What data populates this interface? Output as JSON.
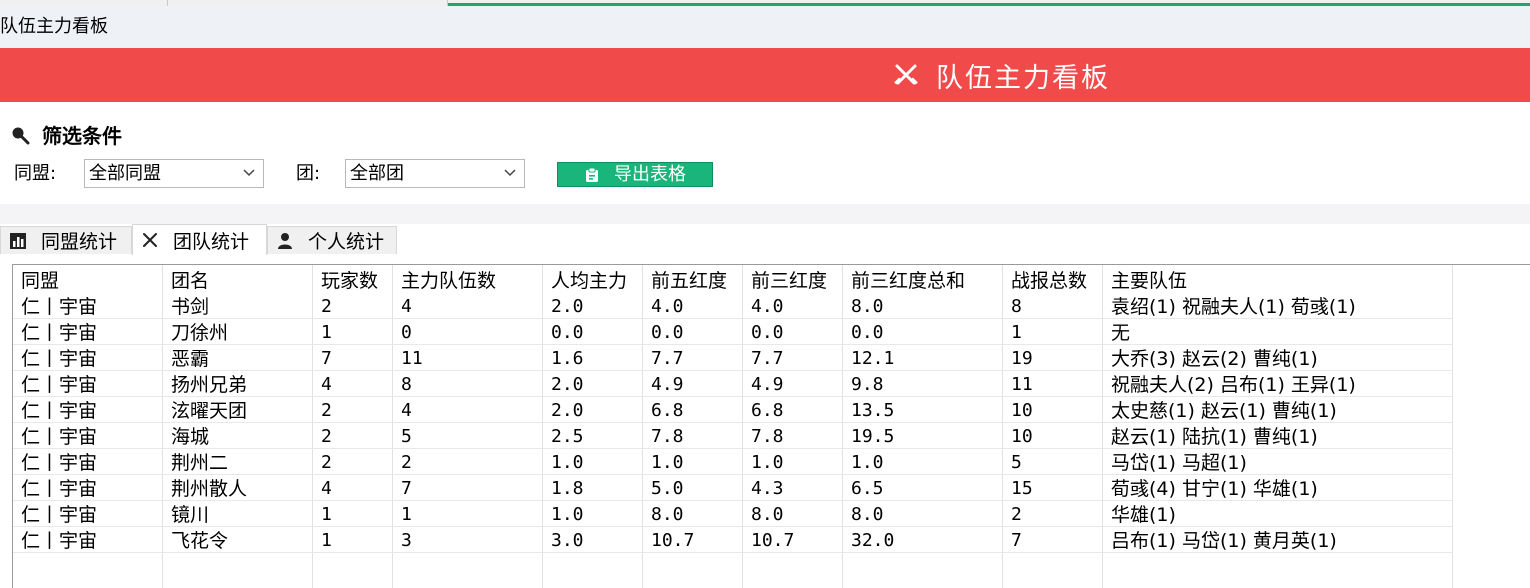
{
  "window": {
    "title": "队伍主力看板"
  },
  "banner": {
    "title": "队伍主力看板",
    "icon": "crossed-swords-icon"
  },
  "filters": {
    "heading": "筛选条件",
    "alliance_label": "同盟:",
    "alliance_value": "全部同盟",
    "group_label": "团:",
    "group_value": "全部团",
    "export_label": "导出表格"
  },
  "tabs": [
    {
      "label": "同盟统计",
      "icon": "bar-chart-icon"
    },
    {
      "label": "团队统计",
      "icon": "crossed-swords-icon"
    },
    {
      "label": "个人统计",
      "icon": "person-icon"
    }
  ],
  "table": {
    "headers": [
      "同盟",
      "团名",
      "玩家数",
      "主力队伍数",
      "人均主力",
      "前五红度",
      "前三红度",
      "前三红度总和",
      "战报总数",
      "主要队伍"
    ],
    "rows": [
      [
        "仁丨宇宙",
        "书剑",
        "2",
        "4",
        "2.0",
        "4.0",
        "4.0",
        "8.0",
        "8",
        "袁绍(1) 祝融夫人(1) 荀彧(1)"
      ],
      [
        "仁丨宇宙",
        "刀徐州",
        "1",
        "0",
        "0.0",
        "0.0",
        "0.0",
        "0.0",
        "1",
        "无"
      ],
      [
        "仁丨宇宙",
        "恶霸",
        "7",
        "11",
        "1.6",
        "7.7",
        "7.7",
        "12.1",
        "19",
        "大乔(3) 赵云(2) 曹纯(1)"
      ],
      [
        "仁丨宇宙",
        "扬州兄弟",
        "4",
        "8",
        "2.0",
        "4.9",
        "4.9",
        "9.8",
        "11",
        "祝融夫人(2) 吕布(1) 王异(1)"
      ],
      [
        "仁丨宇宙",
        "泫曜天团",
        "2",
        "4",
        "2.0",
        "6.8",
        "6.8",
        "13.5",
        "10",
        "太史慈(1) 赵云(1) 曹纯(1)"
      ],
      [
        "仁丨宇宙",
        "海城",
        "2",
        "5",
        "2.5",
        "7.8",
        "7.8",
        "19.5",
        "10",
        "赵云(1) 陆抗(1) 曹纯(1)"
      ],
      [
        "仁丨宇宙",
        "荆州二",
        "2",
        "2",
        "1.0",
        "1.0",
        "1.0",
        "1.0",
        "5",
        "马岱(1) 马超(1)"
      ],
      [
        "仁丨宇宙",
        "荆州散人",
        "4",
        "7",
        "1.8",
        "5.0",
        "4.3",
        "6.5",
        "15",
        "荀彧(4) 甘宁(1) 华雄(1)"
      ],
      [
        "仁丨宇宙",
        "镜川",
        "1",
        "1",
        "1.0",
        "8.0",
        "8.0",
        "8.0",
        "2",
        "华雄(1)"
      ],
      [
        "仁丨宇宙",
        "飞花令",
        "1",
        "3",
        "3.0",
        "10.7",
        "10.7",
        "32.0",
        "7",
        "吕布(1) 马岱(1) 黄月英(1)"
      ]
    ]
  },
  "colors": {
    "banner": "#f04a4a",
    "export_button": "#19b57a",
    "title_bar": "#eef1f6"
  }
}
